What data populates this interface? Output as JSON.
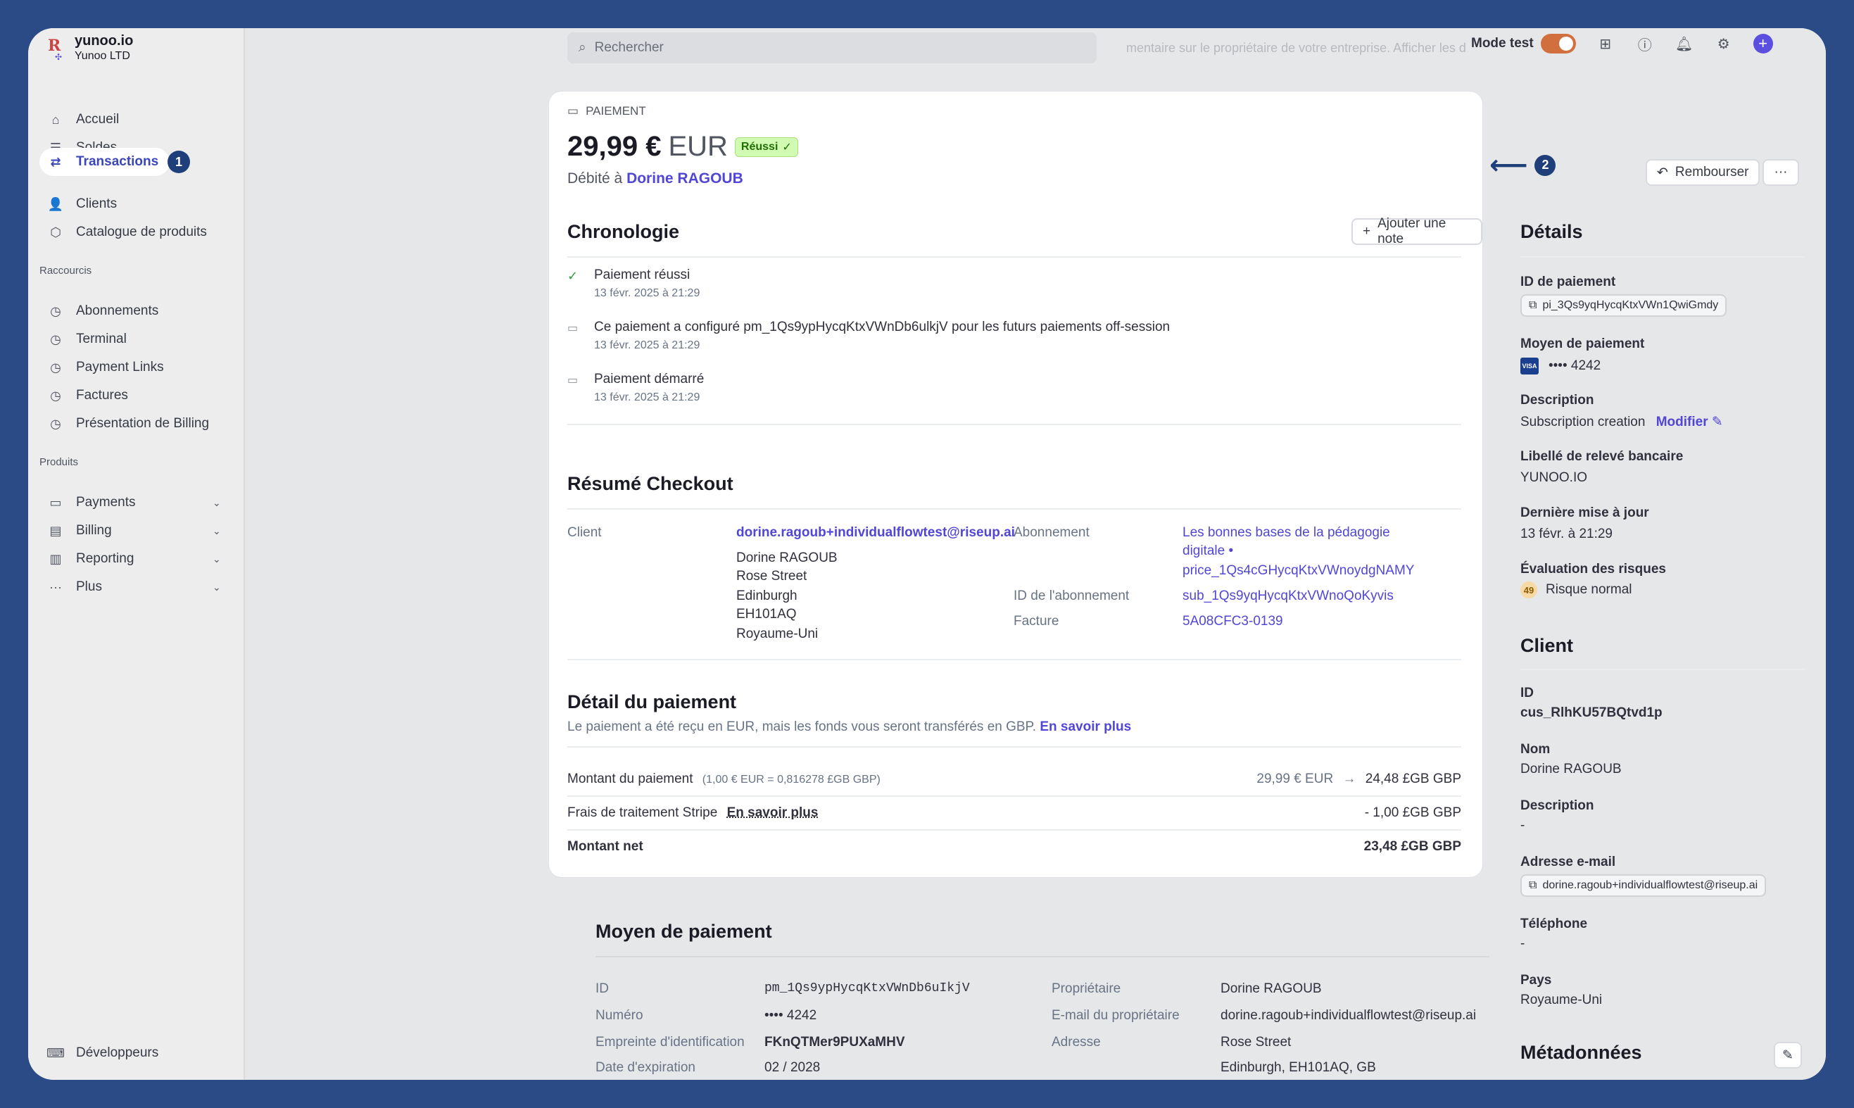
{
  "brand": {
    "name": "yunoo.io",
    "sub": "Yunoo LTD"
  },
  "sidebar": {
    "items": [
      {
        "label": "Accueil",
        "icon": "home-icon"
      },
      {
        "label": "Soldes",
        "icon": "balances-icon"
      },
      {
        "label": "Transactions",
        "icon": "transactions-icon",
        "active": true,
        "step": "1"
      },
      {
        "label": "Clients",
        "icon": "person-icon"
      },
      {
        "label": "Catalogue de produits",
        "icon": "box-icon"
      }
    ],
    "shortcuts_label": "Raccourcis",
    "shortcuts": [
      "Abonnements",
      "Terminal",
      "Payment Links",
      "Factures",
      "Présentation de Billing"
    ],
    "products_label": "Produits",
    "products": [
      "Payments",
      "Billing",
      "Reporting",
      "Plus"
    ],
    "developers": "Développeurs"
  },
  "topbar": {
    "search_placeholder": "Rechercher",
    "mode_test": "Mode test",
    "faded_banner": "mentaire sur le propriétaire de votre entreprise. Afficher les d"
  },
  "payment": {
    "section_label": "PAIEMENT",
    "amount": "29,99 €",
    "currency": "EUR",
    "status": "Réussi",
    "charged_prefix": "Débité à",
    "customer_name": "Dorine RAGOUB",
    "step_2": "2"
  },
  "actions": {
    "refund": "Rembourser",
    "more": "···"
  },
  "timeline": {
    "title": "Chronologie",
    "add_note": "Ajouter une note",
    "events": [
      {
        "text": "Paiement réussi",
        "date": "13 févr. 2025 à 21:29"
      },
      {
        "text": "Ce paiement a configuré pm_1Qs9ypHycqKtxVWnDb6ulkjV pour les futurs paiements off-session",
        "date": "13 févr. 2025 à 21:29"
      },
      {
        "text": "Paiement démarré",
        "date": "13 févr. 2025 à 21:29"
      }
    ]
  },
  "checkout": {
    "title": "Résumé Checkout",
    "client_label": "Client",
    "client_email": "dorine.ragoub+individualflowtest@riseup.ai",
    "address": [
      "Dorine RAGOUB",
      "Rose Street",
      "Edinburgh",
      "EH101AQ",
      "Royaume-Uni"
    ],
    "subscription_label": "Abonnement",
    "subscription_value_1": "Les bonnes bases de la pédagogie",
    "subscription_value_2": "digitale •",
    "subscription_value_3": "price_1Qs4cGHycqKtxVWnoydgNAMY",
    "subscription_id_label": "ID de l'abonnement",
    "subscription_id": "sub_1Qs9yqHycqKtxVWnoQoKyvis",
    "invoice_label": "Facture",
    "invoice": "5A08CFC3-0139"
  },
  "payment_detail": {
    "title": "Détail du paiement",
    "note": "Le paiement a été reçu en EUR, mais les fonds vous seront transférés en GBP.",
    "learn_more": "En savoir plus",
    "rows": {
      "amount_label": "Montant du paiement",
      "amount_rate": "(1,00 € EUR = 0,816278 £GB GBP)",
      "amount_from": "29,99 € EUR",
      "amount_to": "24,48 £GB GBP",
      "fees_label": "Frais de traitement Stripe",
      "fees_link": "En savoir plus",
      "fees_value": "- 1,00 £GB GBP",
      "net_label": "Montant net",
      "net_value": "23,48 £GB GBP"
    }
  },
  "payment_method": {
    "title": "Moyen de paiement",
    "id_label": "ID",
    "id": "pm_1Qs9ypHycqKtxVWnDb6uIkjV",
    "number_label": "Numéro",
    "number": "•••• 4242",
    "fingerprint_label": "Empreinte d'identification",
    "fingerprint": "FKnQTMer9PUXaMHV",
    "expiry_label": "Date d'expiration",
    "expiry": "02 / 2028",
    "owner_label": "Propriétaire",
    "owner": "Dorine RAGOUB",
    "owner_email_label": "E-mail du propriétaire",
    "owner_email": "dorine.ragoub+individualflowtest@riseup.ai",
    "address_label": "Adresse",
    "address_1": "Rose Street",
    "address_2": "Edinburgh, EH101AQ, GB"
  },
  "details": {
    "title": "Détails",
    "payment_id_label": "ID de paiement",
    "payment_id": "pi_3Qs9yqHycqKtxVWn1QwiGmdy",
    "method_label": "Moyen de paiement",
    "method": "•••• 4242",
    "card_brand": "VISA",
    "description_label": "Description",
    "description": "Subscription creation",
    "modify": "Modifier",
    "statement_label": "Libellé de relevé bancaire",
    "statement": "YUNOO.IO",
    "updated_label": "Dernière mise à jour",
    "updated": "13 févr. à 21:29",
    "risk_label": "Évaluation des risques",
    "risk_score": "49",
    "risk": "Risque normal"
  },
  "client": {
    "title": "Client",
    "id_label": "ID",
    "id": "cus_RlhKU57BQtvd1p",
    "name_label": "Nom",
    "name": "Dorine RAGOUB",
    "description_label": "Description",
    "description": "-",
    "email_label": "Adresse e-mail",
    "email": "dorine.ragoub+individualflowtest@riseup.ai",
    "phone_label": "Téléphone",
    "phone": "-",
    "country_label": "Pays",
    "country": "Royaume-Uni"
  },
  "metadata": {
    "title": "Métadonnées"
  },
  "colors": {
    "accent": "#5146d6",
    "success": "#217005",
    "step_badge": "#1f3f7a",
    "toggle": "#d26f3f"
  }
}
